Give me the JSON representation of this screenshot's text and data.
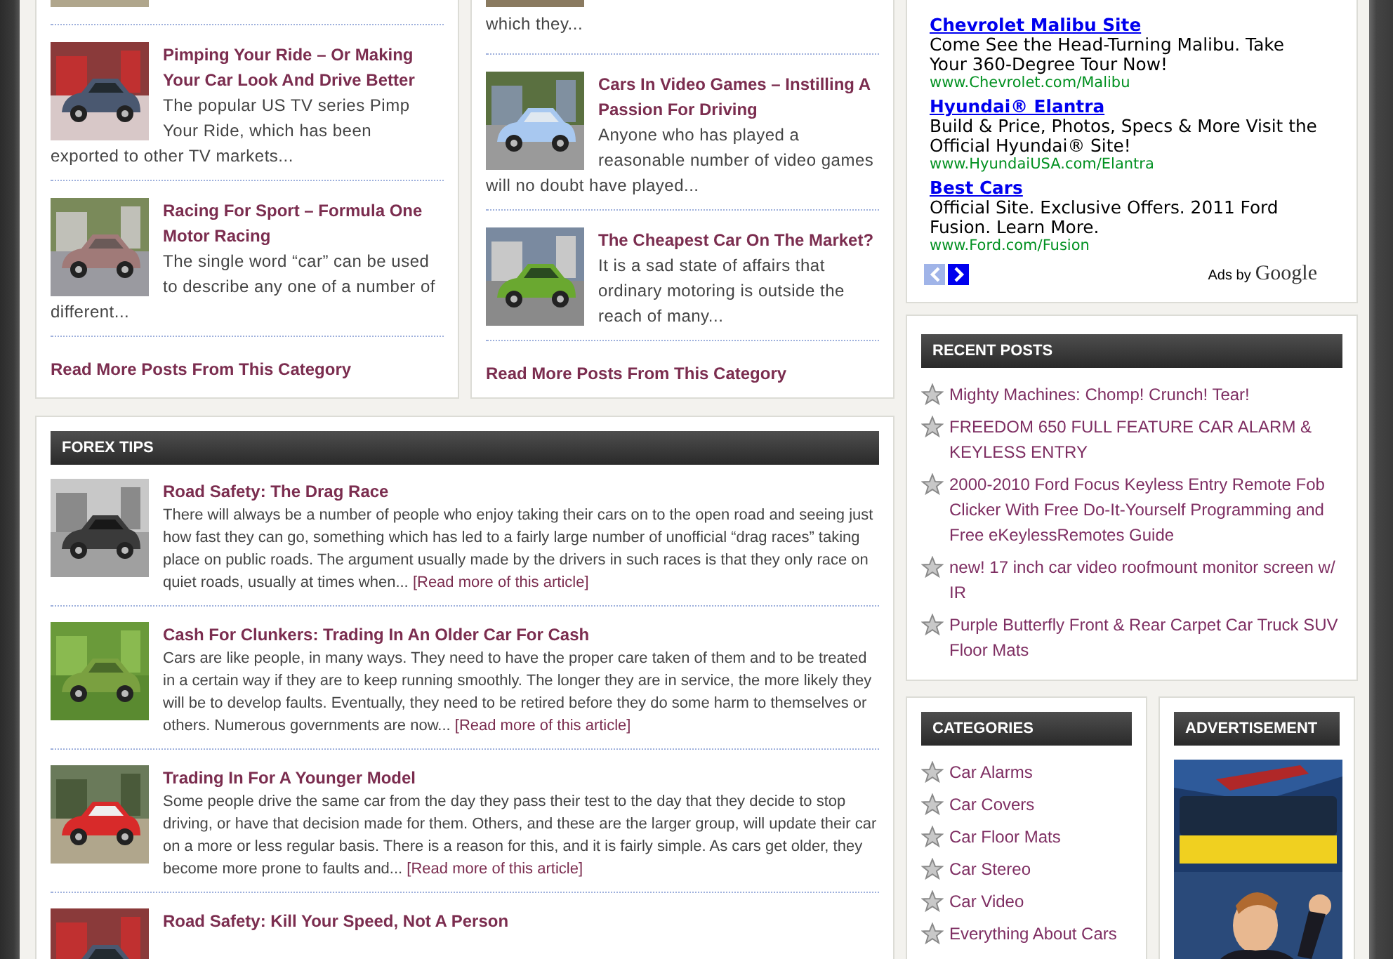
{
  "category_boxes": [
    {
      "posts": [
        {
          "kind": "cut"
        },
        {
          "kind": "post",
          "title": "Pimping Your Ride – Or Making Your Car Look And Drive Better",
          "excerpt": "The popular US TV series Pimp Your Ride, which has been exported to other TV markets..."
        },
        {
          "kind": "post",
          "title": "Racing For Sport – Formula One Motor Racing",
          "excerpt": "The single word “car” can be used to describe any one of a number of different..."
        }
      ],
      "more_link": "Read More Posts From This Category"
    },
    {
      "posts": [
        {
          "kind": "cut",
          "excerpt": "which they..."
        },
        {
          "kind": "post",
          "title": "Cars In Video Games – Instilling A Passion For Driving",
          "excerpt": "Anyone who has played a reasonable number of video games will no doubt have played..."
        },
        {
          "kind": "post",
          "title": "The Cheapest Car On The Market?",
          "excerpt": "It is a sad state of affairs that ordinary motoring is outside the reach of many..."
        }
      ],
      "more_link": "Read More Posts From This Category"
    }
  ],
  "forex_tips": {
    "heading": "FOREX TIPS",
    "posts": [
      {
        "kind": "post",
        "title": "Road Safety: The Drag Race",
        "excerpt": "There will always be a number of people who enjoy taking their cars on to the open road and seeing just how fast they can go, something which has led to a fairly large number of unofficial “drag races” taking place on public roads. The argument usually made by the drivers in such races is that they only race on quiet roads, usually at times when...",
        "read_more": "[Read more of this article]"
      },
      {
        "kind": "post",
        "title": "Cash For Clunkers: Trading In An Older Car For Cash",
        "excerpt": "Cars are like people, in many ways. They need to have the proper care taken of them and to be treated in a certain way if they are to keep running smoothly. The longer they are in service, the more likely they will be to develop faults. Eventually, they need to be retired before they do some harm to themselves or others. Numerous governments are now...",
        "read_more": "[Read more of this article]"
      },
      {
        "kind": "post",
        "title": "Trading In For A Younger Model",
        "excerpt": "Some people drive the same car from the day they pass their test to the day that they decide to stop driving, or have that decision made for them. Others, and these are the larger group, will update their car on a more or less regular basis. There is a reason for this, and it is fairly simple. As cars get older, they become more prone to faults and...",
        "read_more": "[Read more of this article]"
      },
      {
        "kind": "post",
        "title": "Road Safety: Kill Your Speed, Not A Person"
      }
    ]
  },
  "sponsored_links": {
    "ads": [
      {
        "title": "Chevrolet Malibu Site",
        "description": "Come See the Head-Turning Malibu. Take Your 360-Degree Tour Now!",
        "url": "www.Chevrolet.com/Malibu"
      },
      {
        "title": "Hyundai® Elantra",
        "description": "Build & Price, Photos, Specs & More Visit the Official Hyundai® Site!",
        "url": "www.HyundaiUSA.com/Elantra"
      },
      {
        "title": "Best Cars",
        "description": "Official Site. Exclusive Offers. 2011 Ford Fusion. Learn More.",
        "url": "www.Ford.com/Fusion"
      }
    ],
    "prev_disabled": true,
    "next_disabled": false,
    "attribution": "Ads by",
    "brand": "Google"
  },
  "recent_posts": {
    "heading": "RECENT POSTS",
    "items": [
      "Mighty Machines: Chomp! Crunch! Tear!",
      "FREEDOM 650 FULL FEATURE CAR ALARM & KEYLESS ENTRY",
      "2000-2010 Ford Focus Keyless Entry Remote Fob Clicker With Free Do-It-Yourself Programming and Free eKeylessRemotes Guide",
      "new! 17 inch car video roofmount monitor screen w/ IR",
      "Purple Butterfly Front & Rear Carpet Car Truck SUV Floor Mats"
    ]
  },
  "categories": {
    "heading": "CATEGORIES",
    "items": [
      "Car Alarms",
      "Car Covers",
      "Car Floor Mats",
      "Car Stereo",
      "Car Video",
      "Everything About Cars"
    ]
  },
  "advertisement": {
    "heading": "ADVERTISEMENT"
  }
}
